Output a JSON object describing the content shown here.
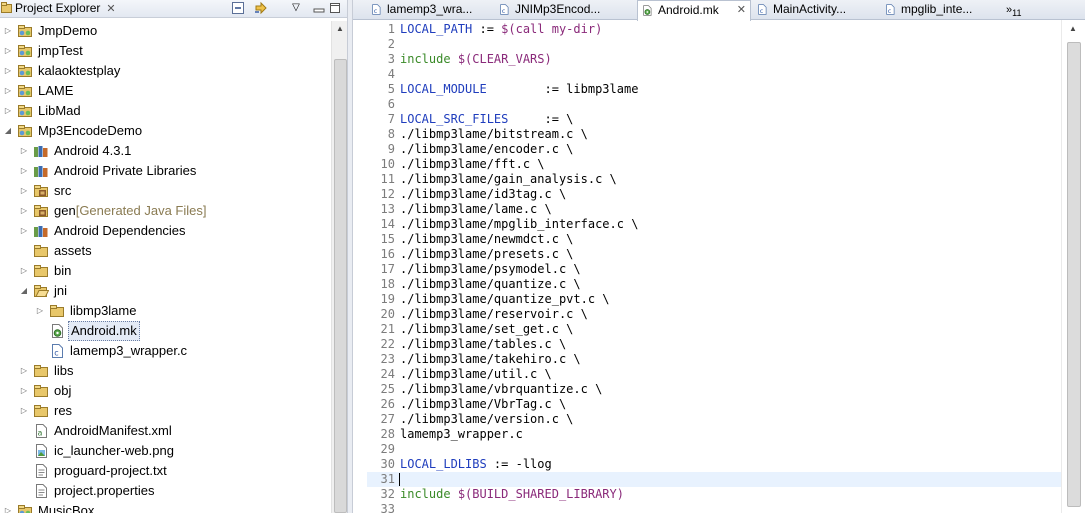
{
  "explorer": {
    "title": "Project Explorer",
    "close_glyph": "✕",
    "view_menu_glyph": "▽",
    "items": [
      {
        "label": "JmpDemo",
        "decoration": "",
        "icon": "project-icon",
        "twisty": "collapsed",
        "depth": 0,
        "name": "project-jmpdemo"
      },
      {
        "label": "jmpTest",
        "decoration": "",
        "icon": "project-icon",
        "twisty": "collapsed",
        "depth": 0,
        "name": "project-jmptest"
      },
      {
        "label": "kalaoktestplay",
        "decoration": "",
        "icon": "project-icon",
        "twisty": "collapsed",
        "depth": 0,
        "name": "project-kalaoktestplay"
      },
      {
        "label": "LAME",
        "decoration": "",
        "icon": "project-icon",
        "twisty": "collapsed",
        "depth": 0,
        "name": "project-lame"
      },
      {
        "label": "LibMad",
        "decoration": "",
        "icon": "project-icon",
        "twisty": "collapsed",
        "depth": 0,
        "name": "project-libmad"
      },
      {
        "label": "Mp3EncodeDemo",
        "decoration": "",
        "icon": "project-icon",
        "twisty": "expanded",
        "depth": 0,
        "name": "project-mp3encodedemo"
      },
      {
        "label": "Android 4.3.1",
        "decoration": "",
        "icon": "library-icon",
        "twisty": "collapsed",
        "depth": 1,
        "name": "node-android-sdk"
      },
      {
        "label": "Android Private Libraries",
        "decoration": "",
        "icon": "library-icon",
        "twisty": "collapsed",
        "depth": 1,
        "name": "node-private-libraries"
      },
      {
        "label": "src",
        "decoration": "",
        "icon": "source-folder-icon",
        "twisty": "collapsed",
        "depth": 1,
        "name": "node-src"
      },
      {
        "label": "gen",
        "decoration": "[Generated Java Files]",
        "icon": "source-folder-icon",
        "twisty": "collapsed",
        "depth": 1,
        "name": "node-gen"
      },
      {
        "label": "Android Dependencies",
        "decoration": "",
        "icon": "library-icon",
        "twisty": "collapsed",
        "depth": 1,
        "name": "node-android-dependencies"
      },
      {
        "label": "assets",
        "decoration": "",
        "icon": "folder-icon",
        "twisty": "none",
        "depth": 1,
        "name": "node-assets"
      },
      {
        "label": "bin",
        "decoration": "",
        "icon": "folder-icon",
        "twisty": "collapsed",
        "depth": 1,
        "name": "node-bin"
      },
      {
        "label": "jni",
        "decoration": "",
        "icon": "folder-open-icon",
        "twisty": "expanded",
        "depth": 1,
        "name": "node-jni"
      },
      {
        "label": "libmp3lame",
        "decoration": "",
        "icon": "folder-icon",
        "twisty": "collapsed",
        "depth": 2,
        "name": "node-libmp3lame"
      },
      {
        "label": "Android.mk",
        "decoration": "",
        "icon": "makefile-icon",
        "twisty": "none",
        "depth": 2,
        "name": "node-android-mk",
        "selected": true
      },
      {
        "label": "lamemp3_wrapper.c",
        "decoration": "",
        "icon": "c-file-icon",
        "twisty": "none",
        "depth": 2,
        "name": "node-lamemp3-wrapper"
      },
      {
        "label": "libs",
        "decoration": "",
        "icon": "folder-icon",
        "twisty": "collapsed",
        "depth": 1,
        "name": "node-libs"
      },
      {
        "label": "obj",
        "decoration": "",
        "icon": "folder-icon",
        "twisty": "collapsed",
        "depth": 1,
        "name": "node-obj"
      },
      {
        "label": "res",
        "decoration": "",
        "icon": "folder-icon",
        "twisty": "collapsed",
        "depth": 1,
        "name": "node-res"
      },
      {
        "label": "AndroidManifest.xml",
        "decoration": "",
        "icon": "xml-file-icon",
        "twisty": "none",
        "depth": 1,
        "name": "node-manifest"
      },
      {
        "label": "ic_launcher-web.png",
        "decoration": "",
        "icon": "image-file-icon",
        "twisty": "none",
        "depth": 1,
        "name": "node-launcher-png"
      },
      {
        "label": "proguard-project.txt",
        "decoration": "",
        "icon": "text-file-icon",
        "twisty": "none",
        "depth": 1,
        "name": "node-proguard"
      },
      {
        "label": "project.properties",
        "decoration": "",
        "icon": "text-file-icon",
        "twisty": "none",
        "depth": 1,
        "name": "node-project-properties"
      },
      {
        "label": "MusicBox",
        "decoration": "",
        "icon": "project-icon",
        "twisty": "collapsed",
        "depth": 0,
        "name": "project-musicbox"
      }
    ]
  },
  "editor": {
    "tabs": [
      {
        "label": "lamemp3_wra...",
        "icon": "c-file-icon",
        "active": false,
        "name": "tab-lamemp3-wrapper"
      },
      {
        "label": "JNIMp3Encod...",
        "icon": "c-file-icon",
        "active": false,
        "name": "tab-jnimp3encode"
      },
      {
        "label": "Android.mk",
        "icon": "makefile-icon",
        "active": true,
        "name": "tab-android-mk"
      },
      {
        "label": "MainActivity...",
        "icon": "c-file-icon",
        "active": false,
        "name": "tab-mainactivity"
      },
      {
        "label": "mpglib_inte...",
        "icon": "c-file-icon",
        "active": false,
        "name": "tab-mpglib-interface"
      }
    ],
    "close_glyph": "✕",
    "overflow_glyph": "»",
    "overflow_count": "11",
    "current_line": 31,
    "lines": [
      {
        "n": "1",
        "text": "LOCAL_PATH := $(call my-dir)",
        "kind": "directive"
      },
      {
        "n": "2",
        "text": "",
        "kind": "plain"
      },
      {
        "n": "3",
        "text": "include $(CLEAR_VARS)",
        "kind": "include"
      },
      {
        "n": "4",
        "text": "",
        "kind": "plain"
      },
      {
        "n": "5",
        "text": "LOCAL_MODULE        := libmp3lame",
        "kind": "directive"
      },
      {
        "n": "6",
        "text": "",
        "kind": "plain"
      },
      {
        "n": "7",
        "text": "LOCAL_SRC_FILES     := \\",
        "kind": "directive"
      },
      {
        "n": "8",
        "text": "./libmp3lame/bitstream.c \\",
        "kind": "plain"
      },
      {
        "n": "9",
        "text": "./libmp3lame/encoder.c \\",
        "kind": "plain"
      },
      {
        "n": "10",
        "text": "./libmp3lame/fft.c \\",
        "kind": "plain"
      },
      {
        "n": "11",
        "text": "./libmp3lame/gain_analysis.c \\",
        "kind": "plain"
      },
      {
        "n": "12",
        "text": "./libmp3lame/id3tag.c \\",
        "kind": "plain"
      },
      {
        "n": "13",
        "text": "./libmp3lame/lame.c \\",
        "kind": "plain"
      },
      {
        "n": "14",
        "text": "./libmp3lame/mpglib_interface.c \\",
        "kind": "plain"
      },
      {
        "n": "15",
        "text": "./libmp3lame/newmdct.c \\",
        "kind": "plain"
      },
      {
        "n": "16",
        "text": "./libmp3lame/presets.c \\",
        "kind": "plain"
      },
      {
        "n": "17",
        "text": "./libmp3lame/psymodel.c \\",
        "kind": "plain"
      },
      {
        "n": "18",
        "text": "./libmp3lame/quantize.c \\",
        "kind": "plain"
      },
      {
        "n": "19",
        "text": "./libmp3lame/quantize_pvt.c \\",
        "kind": "plain"
      },
      {
        "n": "20",
        "text": "./libmp3lame/reservoir.c \\",
        "kind": "plain"
      },
      {
        "n": "21",
        "text": "./libmp3lame/set_get.c \\",
        "kind": "plain"
      },
      {
        "n": "22",
        "text": "./libmp3lame/tables.c \\",
        "kind": "plain"
      },
      {
        "n": "23",
        "text": "./libmp3lame/takehiro.c \\",
        "kind": "plain"
      },
      {
        "n": "24",
        "text": "./libmp3lame/util.c \\",
        "kind": "plain"
      },
      {
        "n": "25",
        "text": "./libmp3lame/vbrquantize.c \\",
        "kind": "plain"
      },
      {
        "n": "26",
        "text": "./libmp3lame/VbrTag.c \\",
        "kind": "plain"
      },
      {
        "n": "27",
        "text": "./libmp3lame/version.c \\",
        "kind": "plain"
      },
      {
        "n": "28",
        "text": "lamemp3_wrapper.c",
        "kind": "plain"
      },
      {
        "n": "29",
        "text": "",
        "kind": "plain"
      },
      {
        "n": "30",
        "text": "LOCAL_LDLIBS := -llog",
        "kind": "directive"
      },
      {
        "n": "31",
        "text": "",
        "kind": "plain"
      },
      {
        "n": "32",
        "text": "include $(BUILD_SHARED_LIBRARY)",
        "kind": "include"
      },
      {
        "n": "33",
        "text": "",
        "kind": "plain"
      }
    ]
  },
  "colors": {
    "directive": "#1f3dbd",
    "include": "#3a8a28",
    "variable": "#8a2a7a",
    "line_number": "#7c7c7c",
    "current_line_bg": "#e8f2fe",
    "selection_bg": "#e4ebf6",
    "decoration": "#8a7b52"
  }
}
